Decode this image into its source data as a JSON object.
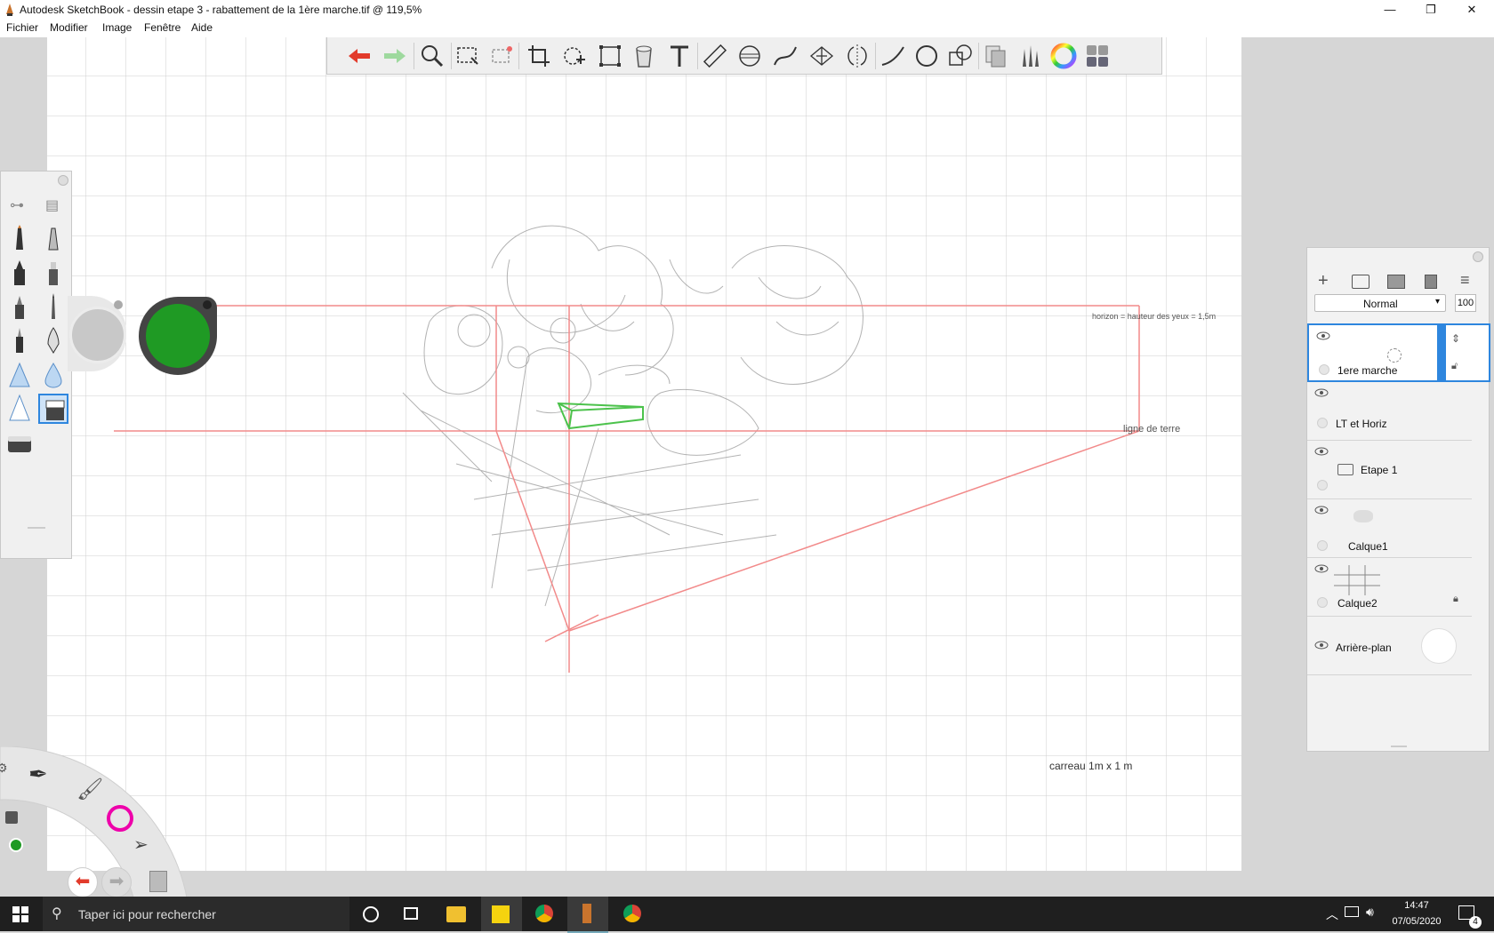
{
  "window": {
    "title": "Autodesk SketchBook - dessin etape 3 - rabattement de la 1ère marche.tif @ 119,5%",
    "controls": [
      "—",
      "❐",
      "✕"
    ]
  },
  "menu": [
    "Fichier",
    "Modifier",
    "Image",
    "Fenêtre",
    "Aide"
  ],
  "toolbar": {
    "icons": [
      "undo-icon",
      "redo-icon",
      "zoom-icon",
      "select-icon",
      "magic-select-icon",
      "crop-icon",
      "transform-icon",
      "distort-icon",
      "fill-icon",
      "text-icon",
      "ruler-icon",
      "ellipse-guide-icon",
      "french-curve-icon",
      "perspective-icon",
      "symmetry-icon",
      "stroke-icon",
      "circle-icon",
      "shape-icon",
      "copy-paste-icon",
      "brush-library-icon",
      "color-wheel-icon",
      "layer-editor-icon"
    ]
  },
  "canvas": {
    "annotations": {
      "horizon": "horizon = hauteur des yeux = 1,5m",
      "ground_line": "ligne de terre",
      "grid_note": "carreau 1m x 1 m"
    }
  },
  "colors": {
    "accent": "#2e86de",
    "current_color": "#1f9a24",
    "guide_red": "#f28a8a",
    "undo_red": "#e23b2b"
  },
  "layers_panel": {
    "blend_mode": "Normal",
    "opacity": "100",
    "layers": [
      {
        "name": "1ere marche",
        "selected": true
      },
      {
        "name": "LT et Horiz",
        "selected": false
      },
      {
        "name": "Etape 1",
        "selected": false
      },
      {
        "name": "Calque1",
        "selected": false
      },
      {
        "name": "Calque2",
        "selected": false
      },
      {
        "name": "Arrière-plan",
        "selected": false
      }
    ]
  },
  "taskbar": {
    "search_placeholder": "Taper ici pour rechercher",
    "time": "14:47",
    "date": "07/05/2020",
    "notifications": "4"
  }
}
